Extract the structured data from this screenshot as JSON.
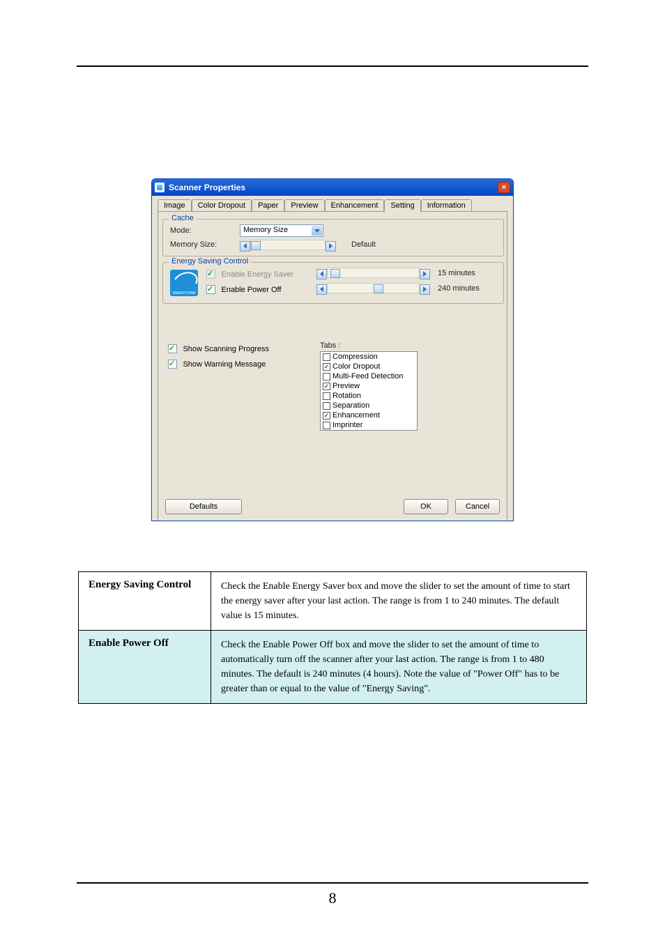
{
  "page_number": "8",
  "dialog": {
    "title": "Scanner Properties",
    "tabs": [
      "Image",
      "Color Dropout",
      "Paper",
      "Preview",
      "Enhancement",
      "Setting",
      "Information"
    ],
    "active_tab": "Setting",
    "cache_legend": "Cache",
    "mode_label": "Mode:",
    "mode_value": "Memory Size",
    "memsize_label": "Memory Size:",
    "memsize_default": "Default",
    "energy_legend": "Energy Saving Control",
    "enable_energy_saver": "Enable Energy Saver",
    "enable_power_off": "Enable Power Off",
    "energy_minutes": "15 minutes",
    "poweroff_minutes": "240 minutes",
    "energy_logo_text": "ENERGY STAR",
    "show_scanning": "Show Scanning Progress",
    "show_warning": "Show Warning Message",
    "tabs_label": "Tabs :",
    "tabs_list": [
      {
        "label": "Compression",
        "checked": false
      },
      {
        "label": "Color Dropout",
        "checked": true
      },
      {
        "label": "Multi-Feed Detection",
        "checked": false
      },
      {
        "label": "Preview",
        "checked": true
      },
      {
        "label": "Rotation",
        "checked": false
      },
      {
        "label": "Separation",
        "checked": false
      },
      {
        "label": "Enhancement",
        "checked": true
      },
      {
        "label": "Imprinter",
        "checked": false
      }
    ],
    "defaults_btn": "Defaults",
    "ok_btn": "OK",
    "cancel_btn": "Cancel"
  },
  "table": {
    "r1_head": "Energy Saving Control",
    "r1_body": "Check the Enable Energy Saver box and move the slider to set the amount of time to start the energy saver after your last action. The range is from 1 to 240 minutes. The default value is 15 minutes.",
    "r2_head": "Enable Power Off",
    "r2_body": "Check the Enable Power Off box and move the slider to set the amount of time to automatically turn off the scanner after your last action. The range is from 1 to 480 minutes. The default is 240 minutes (4 hours). Note the value of \"Power Off\" has to be greater than or equal to the value of \"Energy Saving\"."
  }
}
